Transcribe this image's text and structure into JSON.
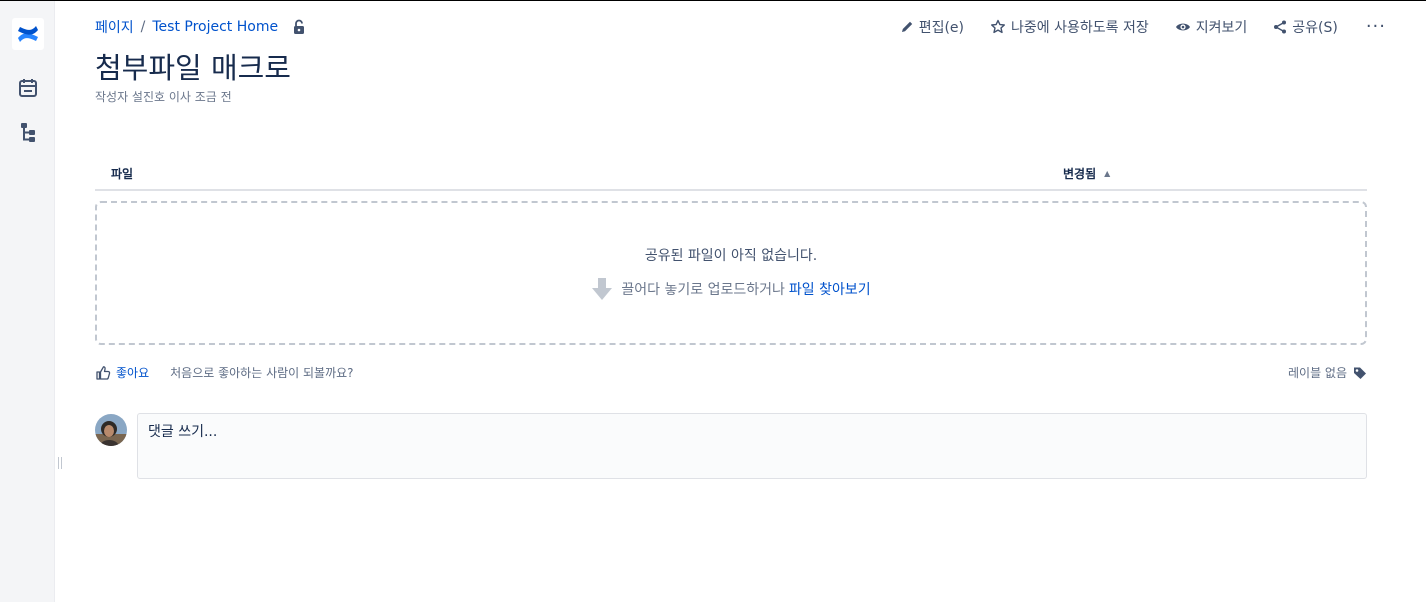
{
  "breadcrumb": {
    "space": "페이지",
    "separator": "/",
    "page": "Test Project Home"
  },
  "actions": {
    "edit": "편집(e)",
    "save_for_later": "나중에 사용하도록 저장",
    "watch": "지켜보기",
    "share": "공유(S)",
    "more": "···"
  },
  "page": {
    "title": "첨부파일 매크로",
    "byline": "작성자 설진호 이사 조금 전"
  },
  "table": {
    "col_file": "파일",
    "col_modified": "변경됨",
    "sort_indicator": "▲"
  },
  "dropzone": {
    "empty_text": "공유된 파일이 아직 없습니다.",
    "hint_text": "끌어다 놓기로 업로드하거나",
    "browse_link": "파일 찾아보기"
  },
  "likes": {
    "like_label": "좋아요",
    "be_first": "처음으로 좋아하는 사람이 되볼까요?"
  },
  "labels": {
    "none": "레이블 없음"
  },
  "comment": {
    "placeholder": "댓글 쓰기..."
  },
  "colors": {
    "brand": "#0052cc",
    "text": "#172b4d",
    "muted": "#6b778c",
    "rail": "#f4f5f7"
  }
}
